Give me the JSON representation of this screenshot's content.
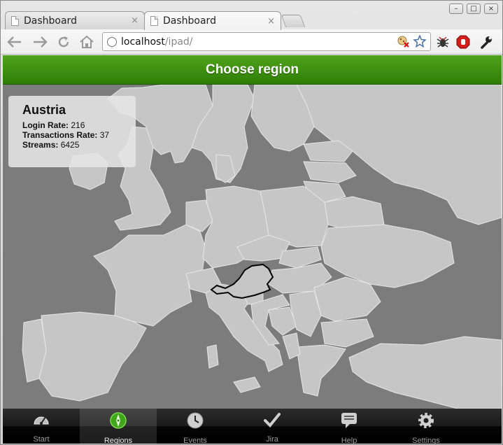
{
  "browser": {
    "tabs": [
      {
        "title": "Dashboard",
        "close": "×"
      },
      {
        "title": "Dashboard",
        "close": "×"
      }
    ],
    "url_host": "localhost",
    "url_path": "/ipad/",
    "window_controls": {
      "minimize": "–",
      "maximize": "□",
      "close": "×"
    }
  },
  "header": {
    "title": "Choose region"
  },
  "info": {
    "region": "Austria",
    "login_label": "Login Rate:",
    "login_value": "216",
    "transactions_label": "Transactions Rate:",
    "transactions_value": "37",
    "streams_label": "Streams:",
    "streams_value": "6425"
  },
  "tabbar": {
    "items": [
      {
        "label": "Start",
        "icon": "speedometer-icon"
      },
      {
        "label": "Regions",
        "icon": "compass-icon"
      },
      {
        "label": "Events",
        "icon": "clock-icon"
      },
      {
        "label": "Jira",
        "icon": "checkmark-icon"
      },
      {
        "label": "Help",
        "icon": "speech-bubble-icon"
      },
      {
        "label": "Settings",
        "icon": "gear-icon"
      }
    ],
    "selected": "Regions"
  },
  "colors": {
    "header_green": "#3f8f12",
    "map_background": "#7c7c7c",
    "land": "#c4c4c4",
    "selected_border": "#000000"
  }
}
